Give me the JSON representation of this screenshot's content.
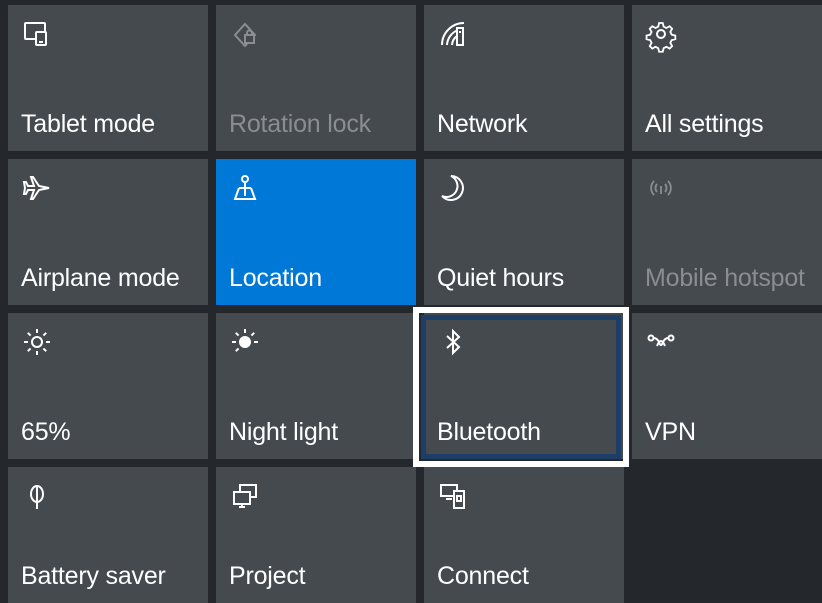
{
  "colors": {
    "background": "#24272b",
    "tile": "#454a4f",
    "active_tile": "#0078d7",
    "disabled_text": "#8a8e92",
    "highlight_outer": "#ffffff",
    "highlight_inner": "#1d3e66"
  },
  "tiles": [
    {
      "label": "Tablet mode",
      "icon": "tablet-mode-icon",
      "state": "normal"
    },
    {
      "label": "Rotation lock",
      "icon": "rotation-lock-icon",
      "state": "disabled"
    },
    {
      "label": "Network",
      "icon": "network-icon",
      "state": "normal"
    },
    {
      "label": "All settings",
      "icon": "gear-icon",
      "state": "normal"
    },
    {
      "label": "Airplane mode",
      "icon": "airplane-icon",
      "state": "normal"
    },
    {
      "label": "Location",
      "icon": "location-icon",
      "state": "active"
    },
    {
      "label": "Quiet hours",
      "icon": "moon-icon",
      "state": "normal"
    },
    {
      "label": "Mobile hotspot",
      "icon": "hotspot-icon",
      "state": "disabled"
    },
    {
      "label": "65%",
      "icon": "brightness-icon",
      "state": "normal"
    },
    {
      "label": "Night light",
      "icon": "night-light-icon",
      "state": "normal"
    },
    {
      "label": "Bluetooth",
      "icon": "bluetooth-icon",
      "state": "highlighted"
    },
    {
      "label": "VPN",
      "icon": "vpn-icon",
      "state": "normal"
    },
    {
      "label": "Battery saver",
      "icon": "battery-saver-icon",
      "state": "normal"
    },
    {
      "label": "Project",
      "icon": "project-icon",
      "state": "normal"
    },
    {
      "label": "Connect",
      "icon": "connect-icon",
      "state": "normal"
    }
  ]
}
